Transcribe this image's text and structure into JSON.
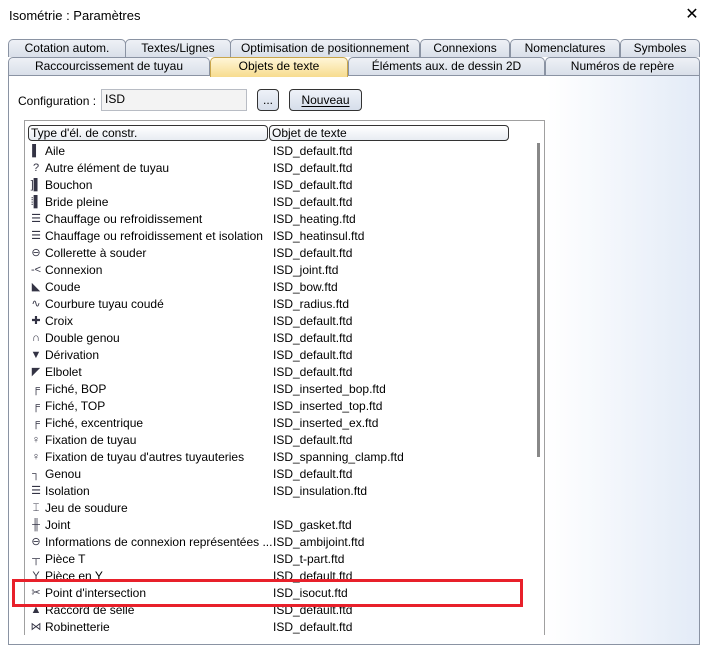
{
  "window": {
    "title": "Isométrie : Paramètres",
    "close": "✕"
  },
  "tabs_row1": [
    "Cotation autom.",
    "Textes/Lignes",
    "Optimisation de positionnement",
    "Connexions",
    "Nomenclatures",
    "Symboles"
  ],
  "tabs_row2": [
    "Raccourcissement de tuyau",
    "Objets de texte",
    "Éléments aux. de dessin 2D",
    "Numéros de repère"
  ],
  "active_tab": "Objets de texte",
  "config": {
    "label": "Configuration :",
    "value": "ISD",
    "browse": "...",
    "new": "Nouveau"
  },
  "table": {
    "headers": [
      "Type d'él. de constr.",
      "Objet de texte"
    ],
    "rows": [
      [
        "Aile",
        "ISD_default.ftd",
        "▌"
      ],
      [
        "Autre élément de tuyau",
        "ISD_default.ftd",
        "?"
      ],
      [
        "Bouchon",
        "ISD_default.ftd",
        "]▌"
      ],
      [
        "Bride pleine",
        "ISD_default.ftd",
        "⁞▌"
      ],
      [
        "Chauffage ou refroidissement",
        "ISD_heating.ftd",
        "☰"
      ],
      [
        "Chauffage ou refroidissement et isolation",
        "ISD_heatinsul.ftd",
        "☰"
      ],
      [
        "Collerette à souder",
        "ISD_default.ftd",
        "⊖"
      ],
      [
        "Connexion",
        "ISD_joint.ftd",
        "-<"
      ],
      [
        "Coude",
        "ISD_bow.ftd",
        "◣"
      ],
      [
        "Courbure tuyau coudé",
        "ISD_radius.ftd",
        "∿"
      ],
      [
        "Croix",
        "ISD_default.ftd",
        "✚"
      ],
      [
        "Double genou",
        "ISD_default.ftd",
        "∩"
      ],
      [
        "Dérivation",
        "ISD_default.ftd",
        "▼"
      ],
      [
        "Elbolet",
        "ISD_default.ftd",
        "◤"
      ],
      [
        "Fiché, BOP",
        "ISD_inserted_bop.ftd",
        "╒"
      ],
      [
        "Fiché, TOP",
        "ISD_inserted_top.ftd",
        "╒"
      ],
      [
        "Fiché, excentrique",
        "ISD_inserted_ex.ftd",
        "╒"
      ],
      [
        "Fixation de tuyau",
        "ISD_default.ftd",
        "♀"
      ],
      [
        "Fixation de tuyau d'autres tuyauteries",
        "ISD_spanning_clamp.ftd",
        "♀"
      ],
      [
        "Genou",
        "ISD_default.ftd",
        "┐"
      ],
      [
        "Isolation",
        "ISD_insulation.ftd",
        "☰"
      ],
      [
        "Jeu de soudure",
        "",
        "⌶"
      ],
      [
        "Joint",
        "ISD_gasket.ftd",
        "╫"
      ],
      [
        "Informations de connexion représentées ...",
        "ISD_ambijoint.ftd",
        "⊖"
      ],
      [
        "Pièce T",
        "ISD_t-part.ftd",
        "┬"
      ],
      [
        "Pièce en Y",
        "ISD_default.ftd",
        "Y"
      ],
      [
        "Point d'intersection",
        "ISD_isocut.ftd",
        "✂"
      ],
      [
        "Raccord de selle",
        "ISD_default.ftd",
        "▲"
      ],
      [
        "Robinetterie",
        "ISD_default.ftd",
        "⋈"
      ]
    ]
  },
  "colors": {
    "highlight": "#e8202a",
    "active_tab": "#f7dc8f"
  }
}
